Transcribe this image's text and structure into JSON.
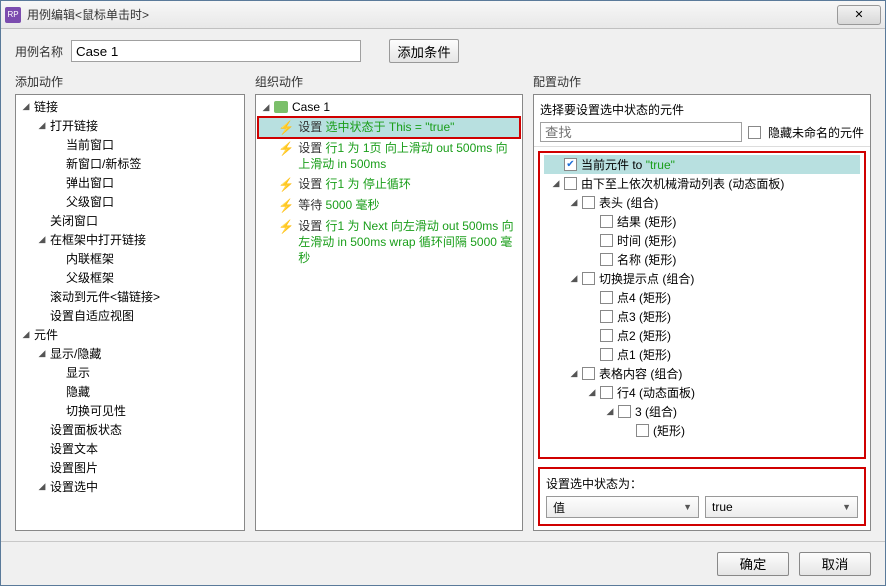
{
  "window": {
    "title": "用例编辑<鼠标单击时>"
  },
  "top": {
    "label_name": "用例名称",
    "case_value": "Case 1",
    "add_condition": "添加条件"
  },
  "columns": {
    "add_action": "添加动作",
    "organize": "组织动作",
    "configure": "配置动作"
  },
  "action_tree": [
    {
      "label": "链接",
      "depth": 0,
      "expand": "open"
    },
    {
      "label": "打开链接",
      "depth": 1,
      "expand": "open"
    },
    {
      "label": "当前窗口",
      "depth": 2,
      "expand": "leaf"
    },
    {
      "label": "新窗口/新标签",
      "depth": 2,
      "expand": "leaf"
    },
    {
      "label": "弹出窗口",
      "depth": 2,
      "expand": "leaf"
    },
    {
      "label": "父级窗口",
      "depth": 2,
      "expand": "leaf"
    },
    {
      "label": "关闭窗口",
      "depth": 1,
      "expand": "leaf"
    },
    {
      "label": "在框架中打开链接",
      "depth": 1,
      "expand": "open"
    },
    {
      "label": "内联框架",
      "depth": 2,
      "expand": "leaf"
    },
    {
      "label": "父级框架",
      "depth": 2,
      "expand": "leaf"
    },
    {
      "label": "滚动到元件<锚链接>",
      "depth": 1,
      "expand": "leaf"
    },
    {
      "label": "设置自适应视图",
      "depth": 1,
      "expand": "leaf"
    },
    {
      "label": "元件",
      "depth": 0,
      "expand": "open"
    },
    {
      "label": "显示/隐藏",
      "depth": 1,
      "expand": "open"
    },
    {
      "label": "显示",
      "depth": 2,
      "expand": "leaf"
    },
    {
      "label": "隐藏",
      "depth": 2,
      "expand": "leaf"
    },
    {
      "label": "切换可见性",
      "depth": 2,
      "expand": "leaf"
    },
    {
      "label": "设置面板状态",
      "depth": 1,
      "expand": "leaf"
    },
    {
      "label": "设置文本",
      "depth": 1,
      "expand": "leaf"
    },
    {
      "label": "设置图片",
      "depth": 1,
      "expand": "leaf"
    },
    {
      "label": "设置选中",
      "depth": 1,
      "expand": "open"
    }
  ],
  "case_header": "Case 1",
  "actions": [
    {
      "prefix": "设置 ",
      "detail": "选中状态于 This = \"true\"",
      "selected": true,
      "wrap": false
    },
    {
      "prefix": "设置 ",
      "detail": "行1 为 1页 向上滑动 out 500ms 向上滑动 in 500ms",
      "selected": false,
      "wrap": true
    },
    {
      "prefix": "设置 ",
      "detail": "行1 为 停止循环",
      "selected": false,
      "wrap": false
    },
    {
      "prefix": "等待 ",
      "detail": "5000 毫秒",
      "selected": false,
      "wrap": false
    },
    {
      "prefix": "设置 ",
      "detail": "行1 为 Next 向左滑动 out 500ms 向左滑动 in 500ms wrap 循环间隔 5000 毫秒",
      "selected": false,
      "wrap": true
    }
  ],
  "config": {
    "title": "选择要设置选中状态的元件",
    "search_placeholder": "查找",
    "hide_unnamed": "隐藏未命名的元件",
    "items": [
      {
        "label": "当前元件 to ",
        "green": "\"true\"",
        "depth": 0,
        "checked": true,
        "tog": "none"
      },
      {
        "label": "由下至上依次机械滑动列表 (动态面板)",
        "depth": 0,
        "tog": "open"
      },
      {
        "label": "表头 (组合)",
        "depth": 1,
        "tog": "open"
      },
      {
        "label": "结果 (矩形)",
        "depth": 2,
        "tog": "leaf"
      },
      {
        "label": "时间 (矩形)",
        "depth": 2,
        "tog": "leaf"
      },
      {
        "label": "名称 (矩形)",
        "depth": 2,
        "tog": "leaf"
      },
      {
        "label": "切换提示点 (组合)",
        "depth": 1,
        "tog": "open"
      },
      {
        "label": "点4 (矩形)",
        "depth": 2,
        "tog": "leaf"
      },
      {
        "label": "点3 (矩形)",
        "depth": 2,
        "tog": "leaf"
      },
      {
        "label": "点2 (矩形)",
        "depth": 2,
        "tog": "leaf"
      },
      {
        "label": "点1 (矩形)",
        "depth": 2,
        "tog": "leaf"
      },
      {
        "label": "表格内容 (组合)",
        "depth": 1,
        "tog": "open"
      },
      {
        "label": "行4 (动态面板)",
        "depth": 2,
        "tog": "open"
      },
      {
        "label": "3 (组合)",
        "depth": 3,
        "tog": "open"
      },
      {
        "label": " (矩形)",
        "depth": 4,
        "tog": "leaf"
      }
    ],
    "bottom_label": "设置选中状态为：",
    "dd1": "值",
    "dd2": "true"
  },
  "footer": {
    "ok": "确定",
    "cancel": "取消"
  }
}
